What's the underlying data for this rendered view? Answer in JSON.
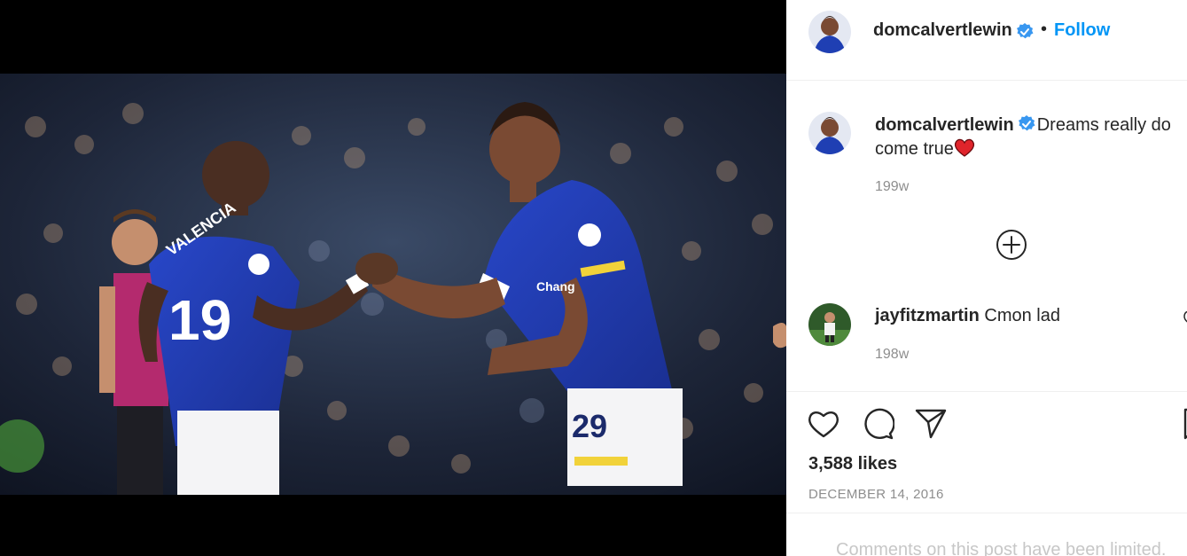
{
  "post": {
    "author": "domcalvertlewin",
    "follow_label": "Follow",
    "separator": "•",
    "photo_alt": "Two footballers in blue kits shaking hands during a match"
  },
  "caption": {
    "username": "domcalvertlewin",
    "text": "Dreams really do come true",
    "emoji": "red-heart",
    "time": "199w"
  },
  "comments": [
    {
      "username": "jayfitzmartin",
      "text": "Cmon lad",
      "time": "198w"
    }
  ],
  "actions": {
    "likes": "3,588 likes",
    "date": "DECEMBER 14, 2016",
    "limited_notice": "Comments on this post have been limited."
  },
  "colors": {
    "accent": "#0095f6",
    "verified": "#3897f0",
    "text": "#262626",
    "muted": "#8e8e8e",
    "kit_blue": "#1f3fb3"
  }
}
